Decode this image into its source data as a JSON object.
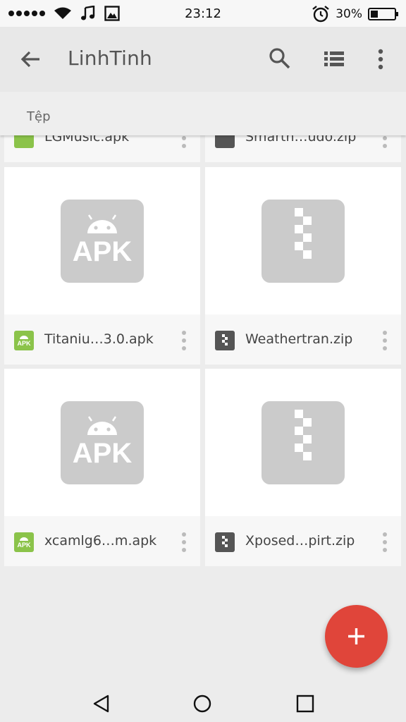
{
  "status_bar": {
    "time": "23:12",
    "battery_percent": "30%",
    "battery_level": 0.3,
    "icons": [
      "signal-dots-icon",
      "wifi-icon",
      "music-icon",
      "image-icon",
      "alarm-icon",
      "battery-icon"
    ]
  },
  "app_bar": {
    "title": "LinhTinh",
    "icons": [
      "back-arrow-icon",
      "search-icon",
      "list-view-icon",
      "more-vert-icon"
    ]
  },
  "section": {
    "label": "Tệp"
  },
  "files": [
    {
      "name": "LGMusic.apk",
      "type": "apk"
    },
    {
      "name": "Smarth…udo.zip",
      "type": "zip"
    },
    {
      "name": "Titaniu…3.0.apk",
      "type": "apk"
    },
    {
      "name": "Weathertran.zip",
      "type": "zip"
    },
    {
      "name": "xcamlg6…m.apk",
      "type": "apk"
    },
    {
      "name": "Xposed…pirt.zip",
      "type": "zip"
    }
  ],
  "thumb_label_apk": "APK",
  "file_icon_label_apk": "APK",
  "colors": {
    "accent_fab": "#e0453a",
    "apk_green": "#8bc34a",
    "zip_dark": "#555555",
    "thumb_gray": "#cbcbcb"
  },
  "fab_icon": "plus-icon",
  "nav_icons": [
    "back-triangle-icon",
    "home-circle-icon",
    "recents-square-icon"
  ]
}
